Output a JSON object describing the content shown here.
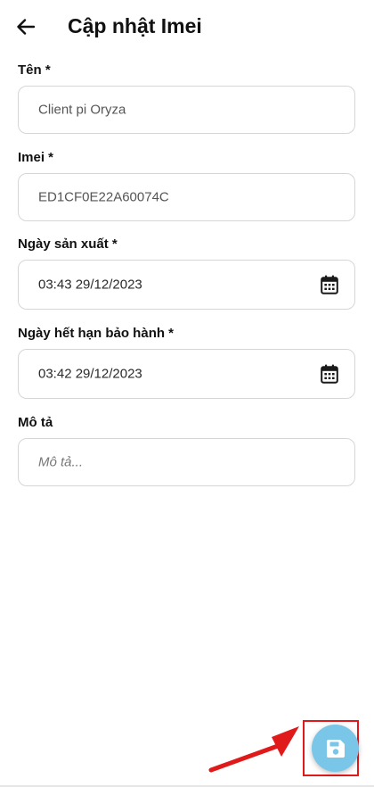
{
  "header": {
    "title": "Cập nhật Imei",
    "back_icon": "arrow-left-icon"
  },
  "form": {
    "name": {
      "label": "Tên *",
      "value": "Client pi Oryza"
    },
    "imei": {
      "label": "Imei *",
      "value": "ED1CF0E22A60074C"
    },
    "manufacture_date": {
      "label": "Ngày sản xuất *",
      "value": "03:43 29/12/2023",
      "icon": "calendar-icon"
    },
    "warranty_date": {
      "label": "Ngày hết hạn bảo hành *",
      "value": "03:42 29/12/2023",
      "icon": "calendar-icon"
    },
    "description": {
      "label": "Mô tả",
      "placeholder": "Mô tả..."
    }
  },
  "fab": {
    "icon": "save-icon",
    "color": "#7ac6e8"
  },
  "annotation": {
    "highlight_color": "#e01a1a",
    "arrow_color": "#e01a1a"
  }
}
